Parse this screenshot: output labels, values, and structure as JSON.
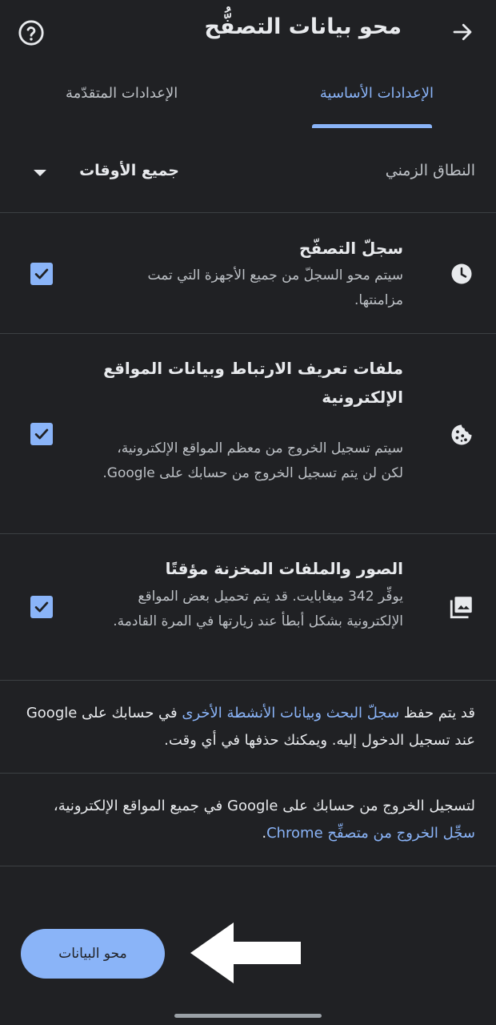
{
  "header": {
    "title": "محو بيانات التصفُّح",
    "back_icon": "arrow-back-icon",
    "help_icon": "help-circle-icon"
  },
  "tabs": [
    {
      "label": "الإعدادات الأساسية",
      "selected": true
    },
    {
      "label": "الإعدادات المتقدّمة",
      "selected": false
    }
  ],
  "time_range": {
    "label": "النطاق الزمني",
    "value": "جميع الأوقات"
  },
  "items": [
    {
      "icon": "clock-icon",
      "title": "سجلّ التصفّح",
      "description": "سيتم محو السجلّ من جميع الأجهزة التي تمت مزامنتها.",
      "checked": true
    },
    {
      "icon": "cookie-icon",
      "title": "ملفات تعريف الارتباط وبيانات المواقع الإلكترونية",
      "description": "سيتم تسجيل الخروج من معظم المواقع الإلكترونية، لكن لن يتم تسجيل الخروج من حسابك على Google.",
      "checked": true
    },
    {
      "icon": "image-gallery-icon",
      "title": "الصور والملفات المخزنة مؤقتًا",
      "description": "يوفِّر 342 ميغابايت. قد يتم تحميل بعض المواقع الإلكترونية بشكل أبطأ عند زيارتها في المرة القادمة.",
      "checked": true
    }
  ],
  "info1": {
    "prefix": "قد يتم حفظ ",
    "link": "سجلّ البحث وبيانات الأنشطة الأخرى",
    "suffix": " في حسابك على Google عند تسجيل الدخول إليه. ويمكنك حذفها في أي وقت."
  },
  "info2": {
    "prefix": "لتسجيل الخروج من حسابك على Google في جميع المواقع الإلكترونية، ",
    "link": "سجِّل الخروج من متصفِّح Chrome",
    "suffix": "."
  },
  "clear_button": {
    "label": "محو البيانات"
  },
  "colors": {
    "background": "#202124",
    "accent": "#8ab4f8",
    "text_primary": "#e8eaed",
    "text_secondary": "#bdc1c6"
  }
}
